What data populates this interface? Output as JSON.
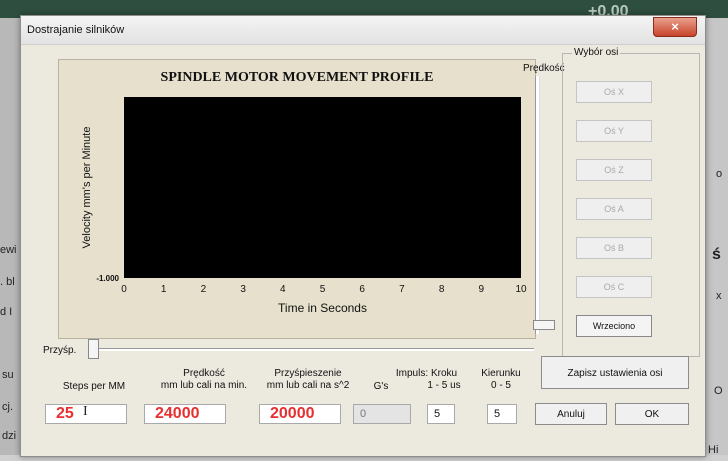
{
  "window": {
    "title": "Dostrajanie silników",
    "close_icon": "×"
  },
  "background": {
    "left_fragments": [
      "ewi",
      ". bl",
      "d I",
      "su",
      "cj.",
      "dzi"
    ],
    "right_fragments": [
      "o",
      "ś",
      "x",
      "O",
      "Hi"
    ],
    "top_number": "+0.00"
  },
  "chart_data": {
    "type": "line",
    "title": "SPINDLE MOTOR MOVEMENT PROFILE",
    "xlabel": "Time in Seconds",
    "ylabel": "Velocity mm's per Minute",
    "x_ticks": [
      "0",
      "1",
      "2",
      "3",
      "4",
      "5",
      "6",
      "7",
      "8",
      "9",
      "10"
    ],
    "y_tick_label": "-1.000",
    "xlim": [
      0,
      10
    ],
    "series": [],
    "colors": {
      "plot_bg": "#000000",
      "panel_bg": "#e6e0cc"
    }
  },
  "speed_slider": {
    "label": "Prędkość"
  },
  "axes_group": {
    "label": "Wybór osi",
    "buttons": [
      {
        "label": "Oś X",
        "enabled": false
      },
      {
        "label": "Oś Y",
        "enabled": false
      },
      {
        "label": "Oś Z",
        "enabled": false
      },
      {
        "label": "Oś A",
        "enabled": false
      },
      {
        "label": "Oś B",
        "enabled": false
      },
      {
        "label": "Oś C",
        "enabled": false
      },
      {
        "label": "Wrzeciono",
        "enabled": true
      }
    ]
  },
  "accel_slider": {
    "label": "Przyśp."
  },
  "fields": {
    "steps": {
      "header": "Steps per MM",
      "value": "25"
    },
    "velocity": {
      "header1": "Prędkość",
      "header2": "mm lub cali na min.",
      "value": "24000"
    },
    "accel": {
      "header1": "Przyśpieszenie",
      "header2": "mm lub cali na s^2",
      "value": "20000"
    },
    "gs": {
      "header": "G's",
      "value": "0"
    },
    "pulse": {
      "header_prefix": "Impuls:",
      "header1": "Kroku",
      "header2": "1 - 5 us",
      "value": "5"
    },
    "dir": {
      "header1": "Kierunku",
      "header2": "0 - 5",
      "value": "5"
    }
  },
  "buttons": {
    "save": "Zapisz ustawienia osi",
    "cancel": "Anuluj",
    "ok": "OK"
  }
}
